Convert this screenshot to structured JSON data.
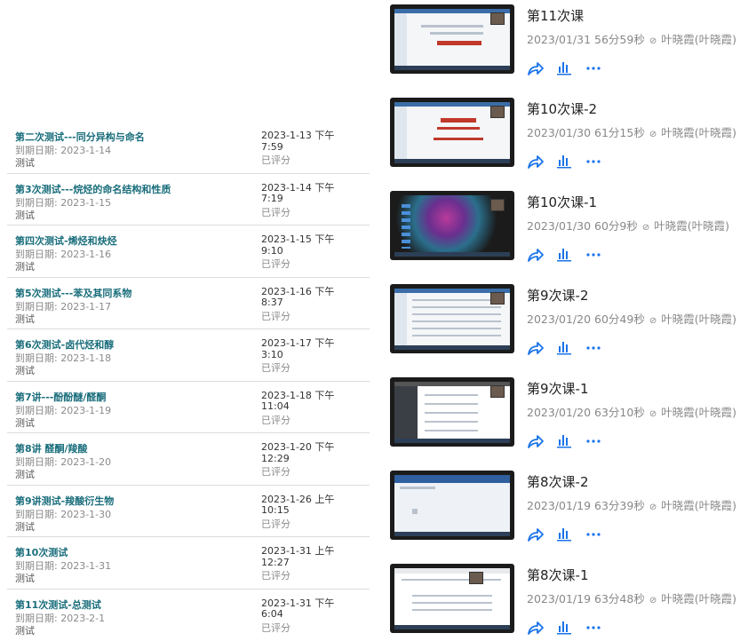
{
  "assignments": [
    {
      "title": "第二次测试---同分异构与命名",
      "due": "到期日期: 2023-1-14",
      "type": "测试",
      "date": "2023-1-13 下午 7:59",
      "status": "已评分"
    },
    {
      "title": "第3次测试---烷烃的命名结构和性质",
      "due": "到期日期: 2023-1-15",
      "type": "测试",
      "date": "2023-1-14 下午 7:19",
      "status": "已评分"
    },
    {
      "title": "第四次测试-烯烃和炔烃",
      "due": "到期日期: 2023-1-16",
      "type": "测试",
      "date": "2023-1-15 下午 9:10",
      "status": "已评分"
    },
    {
      "title": "第5次测试---苯及其同系物",
      "due": "到期日期: 2023-1-17",
      "type": "测试",
      "date": "2023-1-16 下午 8:37",
      "status": "已评分"
    },
    {
      "title": "第6次测试-卤代烃和醇",
      "due": "到期日期: 2023-1-18",
      "type": "测试",
      "date": "2023-1-17 下午 3:10",
      "status": "已评分"
    },
    {
      "title": "第7讲---酚酚醚/醛酮",
      "due": "到期日期: 2023-1-19",
      "type": "测试",
      "date": "2023-1-18 下午 11:04",
      "status": "已评分"
    },
    {
      "title": "第8讲 醛酮/羧酸",
      "due": "到期日期: 2023-1-20",
      "type": "测试",
      "date": "2023-1-20 下午 12:29",
      "status": "已评分"
    },
    {
      "title": "第9讲测试-羧酸衍生物",
      "due": "到期日期: 2023-1-30",
      "type": "测试",
      "date": "2023-1-26 上午 10:15",
      "status": "已评分"
    },
    {
      "title": "第10次测试",
      "due": "到期日期: 2023-1-31",
      "type": "测试",
      "date": "2023-1-31 上午 12:27",
      "status": "已评分"
    },
    {
      "title": "第11次测试-总测试",
      "due": "到期日期: 2023-2-1",
      "type": "测试",
      "date": "2023-1-31 下午 6:04",
      "status": "已评分"
    }
  ],
  "lectures": [
    {
      "title": "第11次课",
      "date": "2023/01/31",
      "duration": "56分59秒",
      "author": "叶晓霞(叶晓霞)",
      "thumb": "slide",
      "icons": [
        "share-icon",
        "stats-icon",
        "more-icon"
      ]
    },
    {
      "title": "第10次课-2",
      "date": "2023/01/30",
      "duration": "61分15秒",
      "author": "叶晓霞(叶晓霞)",
      "thumb": "slide"
    },
    {
      "title": "第10次课-1",
      "date": "2023/01/30",
      "duration": "60分9秒",
      "author": "叶晓霞(叶晓霞)",
      "thumb": "dark"
    },
    {
      "title": "第9次课-2",
      "date": "2023/01/20",
      "duration": "60分49秒",
      "author": "叶晓霞(叶晓霞)",
      "thumb": "table"
    },
    {
      "title": "第9次课-1",
      "date": "2023/01/20",
      "duration": "63分10秒",
      "author": "叶晓霞(叶晓霞)",
      "thumb": "list"
    },
    {
      "title": "第8次课-2",
      "date": "2023/01/19",
      "duration": "63分39秒",
      "author": "叶晓霞(叶晓霞)",
      "thumb": "blue"
    },
    {
      "title": "第8次课-1",
      "date": "2023/01/19",
      "duration": "63分48秒",
      "author": "叶晓霞(叶晓霞)",
      "thumb": "browser"
    }
  ],
  "colors": {
    "link": "#1a6e7c",
    "action": "#1a73e8",
    "muted": "#8a8a8a"
  }
}
